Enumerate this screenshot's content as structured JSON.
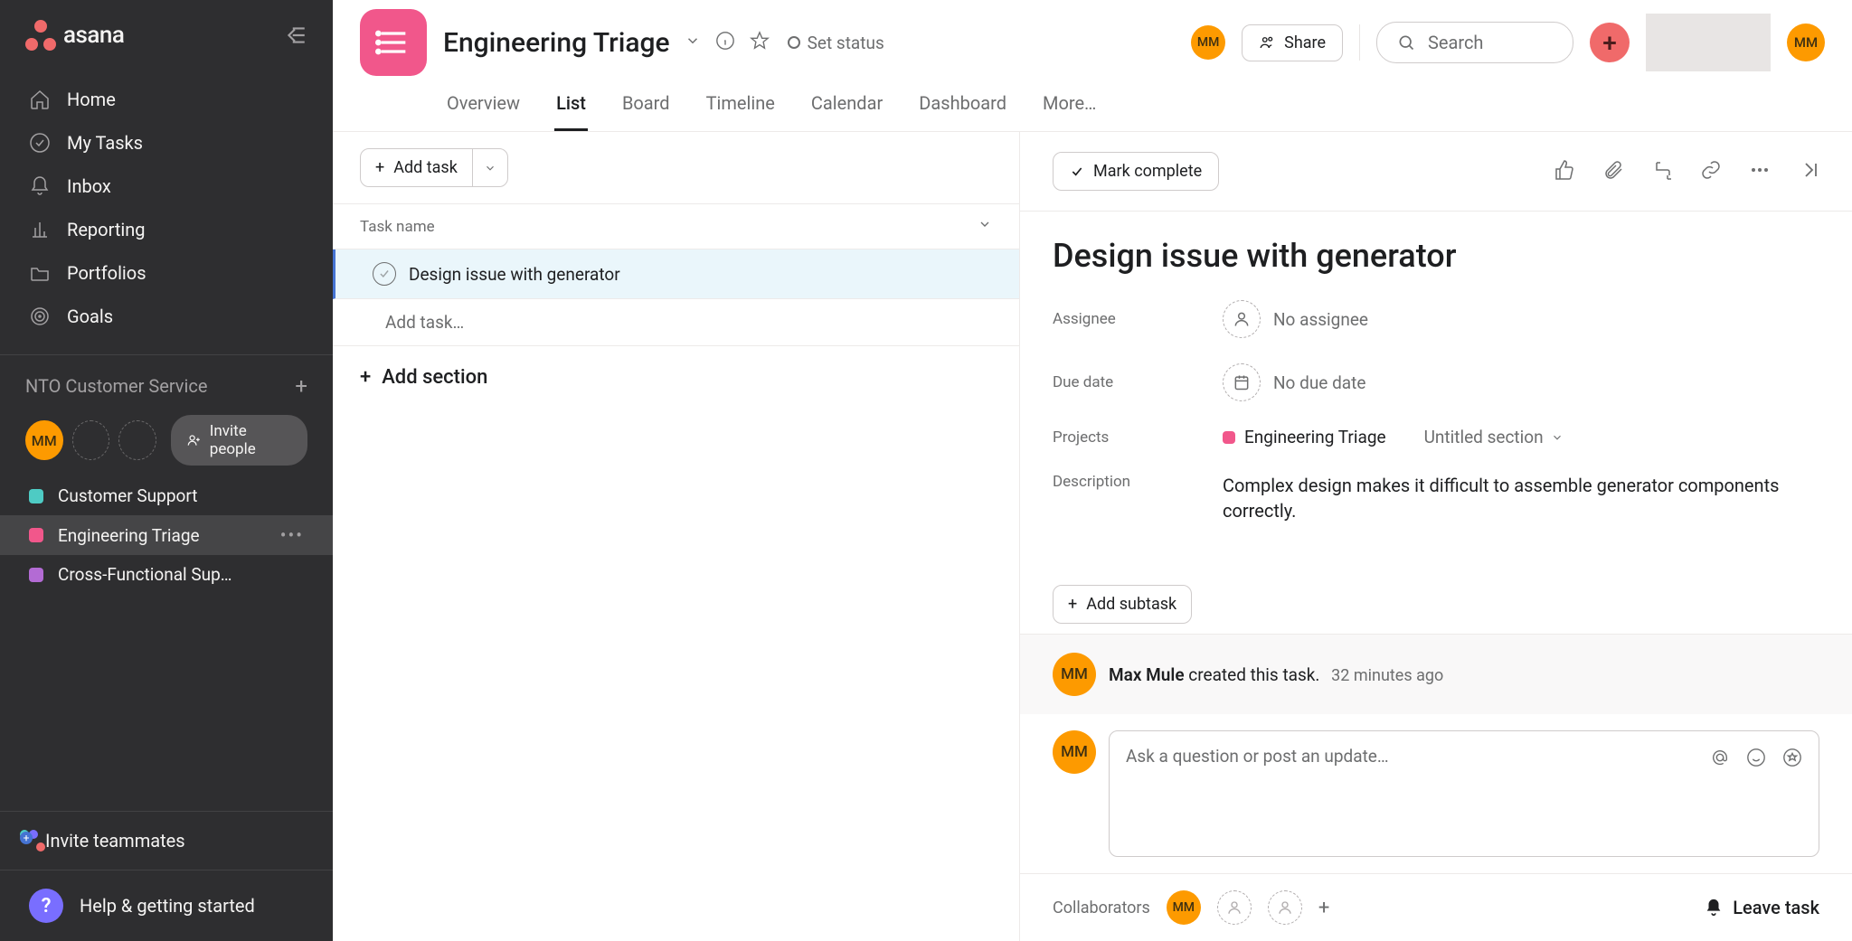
{
  "brand": {
    "name": "asana"
  },
  "sidebar": {
    "nav": [
      {
        "label": "Home"
      },
      {
        "label": "My Tasks"
      },
      {
        "label": "Inbox"
      },
      {
        "label": "Reporting"
      },
      {
        "label": "Portfolios"
      },
      {
        "label": "Goals"
      }
    ],
    "workspace": {
      "name": "NTO Customer Service"
    },
    "user_avatar": "MM",
    "invite_people": "Invite people",
    "projects": [
      {
        "label": "Customer Support",
        "color": "cyan"
      },
      {
        "label": "Engineering Triage",
        "color": "pink",
        "active": true
      },
      {
        "label": "Cross-Functional Sup…",
        "color": "purple"
      }
    ],
    "invite_teammates": "Invite teammates",
    "help": "Help & getting started"
  },
  "header": {
    "project_title": "Engineering Triage",
    "set_status": "Set status",
    "share": "Share",
    "search_placeholder": "Search",
    "avatar": "MM",
    "top_avatar": "MM",
    "tabs": [
      {
        "label": "Overview"
      },
      {
        "label": "List",
        "active": true
      },
      {
        "label": "Board"
      },
      {
        "label": "Timeline"
      },
      {
        "label": "Calendar"
      },
      {
        "label": "Dashboard"
      },
      {
        "label": "More…"
      }
    ]
  },
  "list": {
    "add_task": "Add task",
    "column_header": "Task name",
    "tasks": [
      {
        "title": "Design issue with generator"
      }
    ],
    "add_task_placeholder": "Add task…",
    "add_section": "Add section"
  },
  "detail": {
    "mark_complete": "Mark complete",
    "title": "Design issue with generator",
    "fields": {
      "assignee_label": "Assignee",
      "assignee_value": "No assignee",
      "due_label": "Due date",
      "due_value": "No due date",
      "projects_label": "Projects",
      "project_name": "Engineering Triage",
      "section_name": "Untitled section",
      "description_label": "Description",
      "description_text": "Complex design makes it difficult to assemble generator components correctly."
    },
    "add_subtask": "Add subtask",
    "activity": {
      "avatar": "MM",
      "actor": "Max Mule",
      "action": "created this task.",
      "time": "32 minutes ago"
    },
    "comment": {
      "avatar": "MM",
      "placeholder": "Ask a question or post an update…"
    },
    "collaborators": {
      "label": "Collaborators",
      "avatar": "MM",
      "leave": "Leave task"
    }
  }
}
